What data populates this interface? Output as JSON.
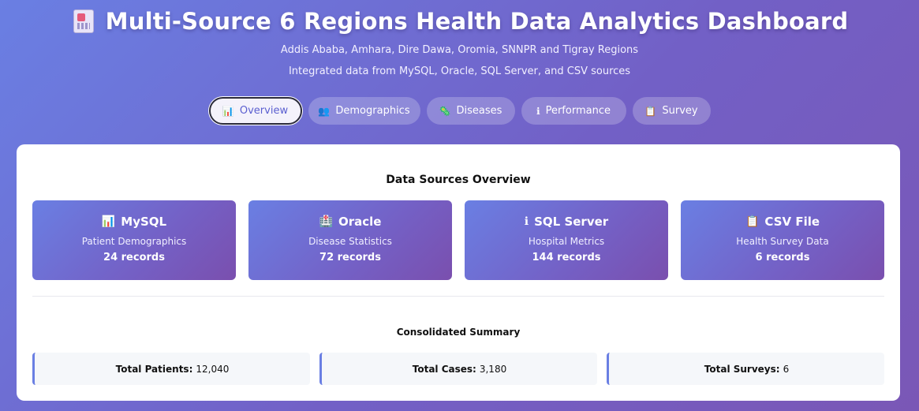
{
  "header": {
    "title": "Multi-Source 6 Regions Health Data Analytics Dashboard",
    "title_icon": "hospital-icon",
    "subtitle": "Addis Ababa, Amhara, Dire Dawa, Oromia, SNNPR and Tigray Regions",
    "subtitle2": "Integrated data from MySQL, Oracle, SQL Server, and CSV sources"
  },
  "tabs": [
    {
      "label": "Overview",
      "icon": "bar-chart-icon",
      "glyph": "📊",
      "active": true
    },
    {
      "label": "Demographics",
      "icon": "people-icon",
      "glyph": "👥",
      "active": false
    },
    {
      "label": "Diseases",
      "icon": "microbe-icon",
      "glyph": "🦠",
      "active": false
    },
    {
      "label": "Performance",
      "icon": "info-icon",
      "glyph": "ℹ",
      "active": false
    },
    {
      "label": "Survey",
      "icon": "clipboard-icon",
      "glyph": "📋",
      "active": false
    }
  ],
  "overview": {
    "title": "Data Sources Overview",
    "cards": [
      {
        "name": "MySQL",
        "icon": "bar-chart-icon",
        "glyph": "📊",
        "desc": "Patient Demographics",
        "records": "24 records"
      },
      {
        "name": "Oracle",
        "icon": "hospital-icon",
        "glyph": "🏥",
        "desc": "Disease Statistics",
        "records": "72 records"
      },
      {
        "name": "SQL Server",
        "icon": "info-icon",
        "glyph": "ℹ",
        "desc": "Hospital Metrics",
        "records": "144 records"
      },
      {
        "name": "CSV File",
        "icon": "clipboard-icon",
        "glyph": "📋",
        "desc": "Health Survey Data",
        "records": "6 records"
      }
    ]
  },
  "summary": {
    "title": "Consolidated Summary",
    "items": [
      {
        "label": "Total Patients:",
        "value": "12,040"
      },
      {
        "label": "Total Cases:",
        "value": "3,180"
      },
      {
        "label": "Total Surveys:",
        "value": "6"
      }
    ]
  },
  "colors": {
    "accent": "#6a7fe3",
    "accent2": "#7a4fae",
    "active_tab_text": "#5b5fd0"
  }
}
